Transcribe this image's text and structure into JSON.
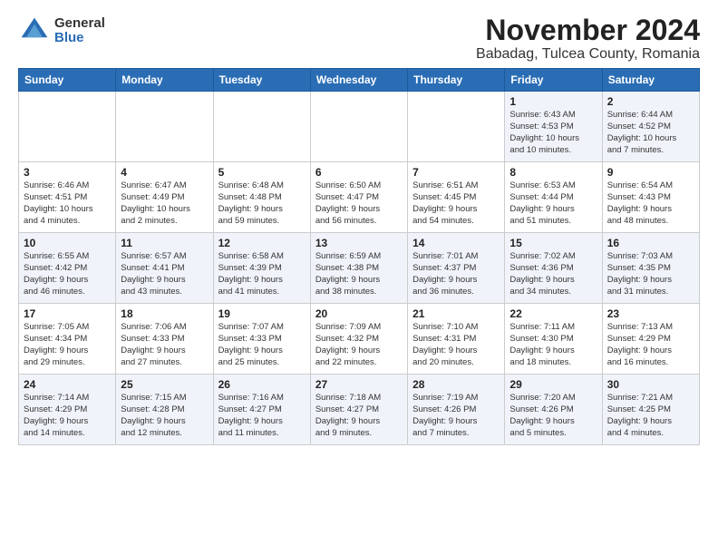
{
  "logo": {
    "general": "General",
    "blue": "Blue"
  },
  "title": {
    "month": "November 2024",
    "location": "Babadag, Tulcea County, Romania"
  },
  "weekdays": [
    "Sunday",
    "Monday",
    "Tuesday",
    "Wednesday",
    "Thursday",
    "Friday",
    "Saturday"
  ],
  "weeks": [
    [
      {
        "day": "",
        "info": ""
      },
      {
        "day": "",
        "info": ""
      },
      {
        "day": "",
        "info": ""
      },
      {
        "day": "",
        "info": ""
      },
      {
        "day": "",
        "info": ""
      },
      {
        "day": "1",
        "info": "Sunrise: 6:43 AM\nSunset: 4:53 PM\nDaylight: 10 hours\nand 10 minutes."
      },
      {
        "day": "2",
        "info": "Sunrise: 6:44 AM\nSunset: 4:52 PM\nDaylight: 10 hours\nand 7 minutes."
      }
    ],
    [
      {
        "day": "3",
        "info": "Sunrise: 6:46 AM\nSunset: 4:51 PM\nDaylight: 10 hours\nand 4 minutes."
      },
      {
        "day": "4",
        "info": "Sunrise: 6:47 AM\nSunset: 4:49 PM\nDaylight: 10 hours\nand 2 minutes."
      },
      {
        "day": "5",
        "info": "Sunrise: 6:48 AM\nSunset: 4:48 PM\nDaylight: 9 hours\nand 59 minutes."
      },
      {
        "day": "6",
        "info": "Sunrise: 6:50 AM\nSunset: 4:47 PM\nDaylight: 9 hours\nand 56 minutes."
      },
      {
        "day": "7",
        "info": "Sunrise: 6:51 AM\nSunset: 4:45 PM\nDaylight: 9 hours\nand 54 minutes."
      },
      {
        "day": "8",
        "info": "Sunrise: 6:53 AM\nSunset: 4:44 PM\nDaylight: 9 hours\nand 51 minutes."
      },
      {
        "day": "9",
        "info": "Sunrise: 6:54 AM\nSunset: 4:43 PM\nDaylight: 9 hours\nand 48 minutes."
      }
    ],
    [
      {
        "day": "10",
        "info": "Sunrise: 6:55 AM\nSunset: 4:42 PM\nDaylight: 9 hours\nand 46 minutes."
      },
      {
        "day": "11",
        "info": "Sunrise: 6:57 AM\nSunset: 4:41 PM\nDaylight: 9 hours\nand 43 minutes."
      },
      {
        "day": "12",
        "info": "Sunrise: 6:58 AM\nSunset: 4:39 PM\nDaylight: 9 hours\nand 41 minutes."
      },
      {
        "day": "13",
        "info": "Sunrise: 6:59 AM\nSunset: 4:38 PM\nDaylight: 9 hours\nand 38 minutes."
      },
      {
        "day": "14",
        "info": "Sunrise: 7:01 AM\nSunset: 4:37 PM\nDaylight: 9 hours\nand 36 minutes."
      },
      {
        "day": "15",
        "info": "Sunrise: 7:02 AM\nSunset: 4:36 PM\nDaylight: 9 hours\nand 34 minutes."
      },
      {
        "day": "16",
        "info": "Sunrise: 7:03 AM\nSunset: 4:35 PM\nDaylight: 9 hours\nand 31 minutes."
      }
    ],
    [
      {
        "day": "17",
        "info": "Sunrise: 7:05 AM\nSunset: 4:34 PM\nDaylight: 9 hours\nand 29 minutes."
      },
      {
        "day": "18",
        "info": "Sunrise: 7:06 AM\nSunset: 4:33 PM\nDaylight: 9 hours\nand 27 minutes."
      },
      {
        "day": "19",
        "info": "Sunrise: 7:07 AM\nSunset: 4:33 PM\nDaylight: 9 hours\nand 25 minutes."
      },
      {
        "day": "20",
        "info": "Sunrise: 7:09 AM\nSunset: 4:32 PM\nDaylight: 9 hours\nand 22 minutes."
      },
      {
        "day": "21",
        "info": "Sunrise: 7:10 AM\nSunset: 4:31 PM\nDaylight: 9 hours\nand 20 minutes."
      },
      {
        "day": "22",
        "info": "Sunrise: 7:11 AM\nSunset: 4:30 PM\nDaylight: 9 hours\nand 18 minutes."
      },
      {
        "day": "23",
        "info": "Sunrise: 7:13 AM\nSunset: 4:29 PM\nDaylight: 9 hours\nand 16 minutes."
      }
    ],
    [
      {
        "day": "24",
        "info": "Sunrise: 7:14 AM\nSunset: 4:29 PM\nDaylight: 9 hours\nand 14 minutes."
      },
      {
        "day": "25",
        "info": "Sunrise: 7:15 AM\nSunset: 4:28 PM\nDaylight: 9 hours\nand 12 minutes."
      },
      {
        "day": "26",
        "info": "Sunrise: 7:16 AM\nSunset: 4:27 PM\nDaylight: 9 hours\nand 11 minutes."
      },
      {
        "day": "27",
        "info": "Sunrise: 7:18 AM\nSunset: 4:27 PM\nDaylight: 9 hours\nand 9 minutes."
      },
      {
        "day": "28",
        "info": "Sunrise: 7:19 AM\nSunset: 4:26 PM\nDaylight: 9 hours\nand 7 minutes."
      },
      {
        "day": "29",
        "info": "Sunrise: 7:20 AM\nSunset: 4:26 PM\nDaylight: 9 hours\nand 5 minutes."
      },
      {
        "day": "30",
        "info": "Sunrise: 7:21 AM\nSunset: 4:25 PM\nDaylight: 9 hours\nand 4 minutes."
      }
    ]
  ]
}
